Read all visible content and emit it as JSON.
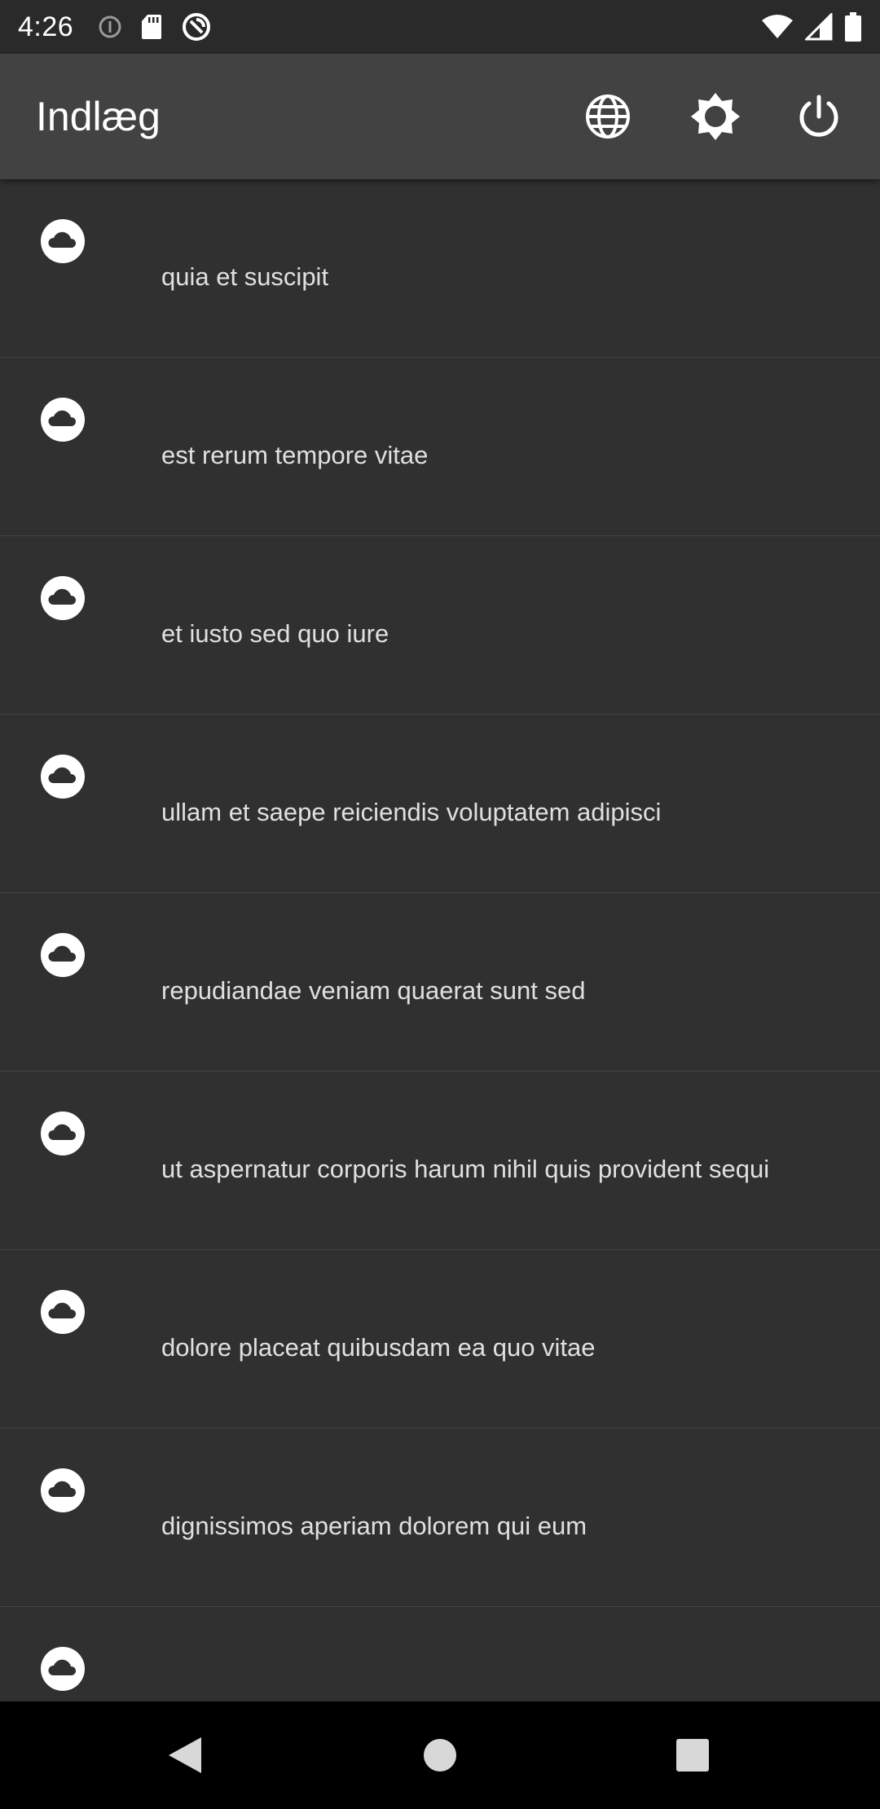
{
  "status_bar": {
    "time": "4:26"
  },
  "app_bar": {
    "title": "Indlæg",
    "actions": [
      {
        "icon": "globe-icon"
      },
      {
        "icon": "brightness-icon"
      },
      {
        "icon": "power-icon"
      }
    ]
  },
  "posts": [
    {
      "title": "quia et suscipit"
    },
    {
      "title": "est rerum tempore vitae"
    },
    {
      "title": "et iusto sed quo iure"
    },
    {
      "title": "ullam et saepe reiciendis voluptatem adipisci"
    },
    {
      "title": "repudiandae veniam quaerat sunt sed"
    },
    {
      "title": "ut aspernatur corporis harum nihil quis provident sequi"
    },
    {
      "title": "dolore placeat quibusdam ea quo vitae"
    },
    {
      "title": "dignissimos aperiam dolorem qui eum"
    },
    {
      "title": ""
    }
  ],
  "colors": {
    "background": "#303030",
    "app_bar": "#424242",
    "status_bar": "#2a2a2a",
    "nav_bar": "#000000",
    "text": "#e0e0e0"
  }
}
